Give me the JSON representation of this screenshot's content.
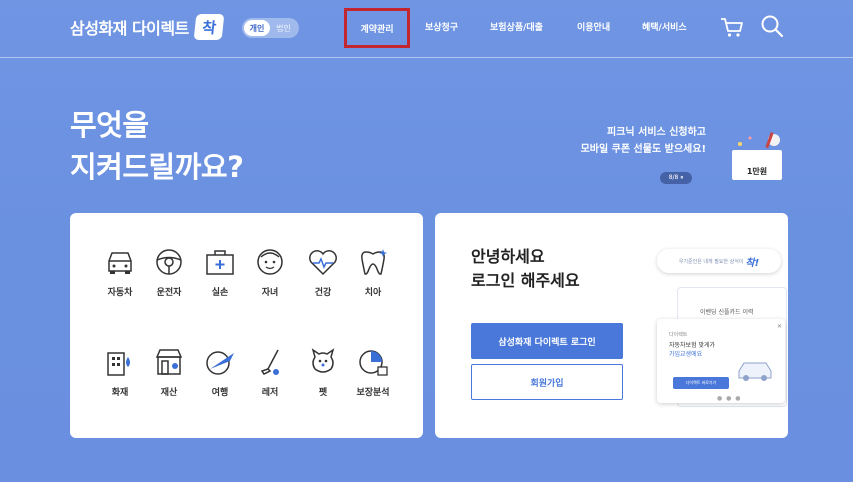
{
  "header": {
    "logo_text": "삼성화재 다이렉트",
    "logo_badge": "착",
    "toggle": {
      "active": "개인",
      "inactive": "법인"
    },
    "nav": [
      {
        "label": "계약관리",
        "highlighted": true
      },
      {
        "label": "보상청구"
      },
      {
        "label": "보험상품/대출"
      },
      {
        "label": "이용안내"
      },
      {
        "label": "혜택/서비스"
      }
    ],
    "icons": [
      "cart-icon",
      "search-icon"
    ]
  },
  "hero": {
    "title_line1": "무엇을",
    "title_line2": "지켜드릴까요?"
  },
  "promo": {
    "line1": "피크닉 서비스 신청하고",
    "line2": "모바일 쿠폰 선물도 받으세요!",
    "pager": "8/8 ⏸",
    "card_label": "1만원"
  },
  "categories": [
    {
      "label": "자동차",
      "icon": "car-icon"
    },
    {
      "label": "운전자",
      "icon": "steering-wheel-icon"
    },
    {
      "label": "실손",
      "icon": "first-aid-kit-icon"
    },
    {
      "label": "자녀",
      "icon": "child-face-icon"
    },
    {
      "label": "건강",
      "icon": "heart-pulse-icon"
    },
    {
      "label": "치아",
      "icon": "tooth-icon"
    },
    {
      "label": "화재",
      "icon": "building-fire-icon"
    },
    {
      "label": "재산",
      "icon": "store-icon"
    },
    {
      "label": "여행",
      "icon": "plane-globe-icon"
    },
    {
      "label": "레저",
      "icon": "golf-icon"
    },
    {
      "label": "펫",
      "icon": "pet-icon"
    },
    {
      "label": "보장분석",
      "icon": "analysis-chart-icon"
    }
  ],
  "login": {
    "greeting_line1": "안녕하세요",
    "greeting_line2": "로그인 해주세요",
    "login_button": "삼성화재 다이렉트 로그인",
    "join_button": "회원가입",
    "bubble_text": "우기준인은 내게 필요한 상식이",
    "bubble_accent": "착!",
    "phone_back_text": "이벤딩 신플카드 이력",
    "phone_front_small": "다이렉트",
    "phone_front_line1": "자동차보험 맞게가",
    "phone_front_line2": "가입교생에요",
    "phone_front_button": "다이렉트 바로가기",
    "phone_front_dots": "● ● ●",
    "phone_front_close": "✕"
  }
}
